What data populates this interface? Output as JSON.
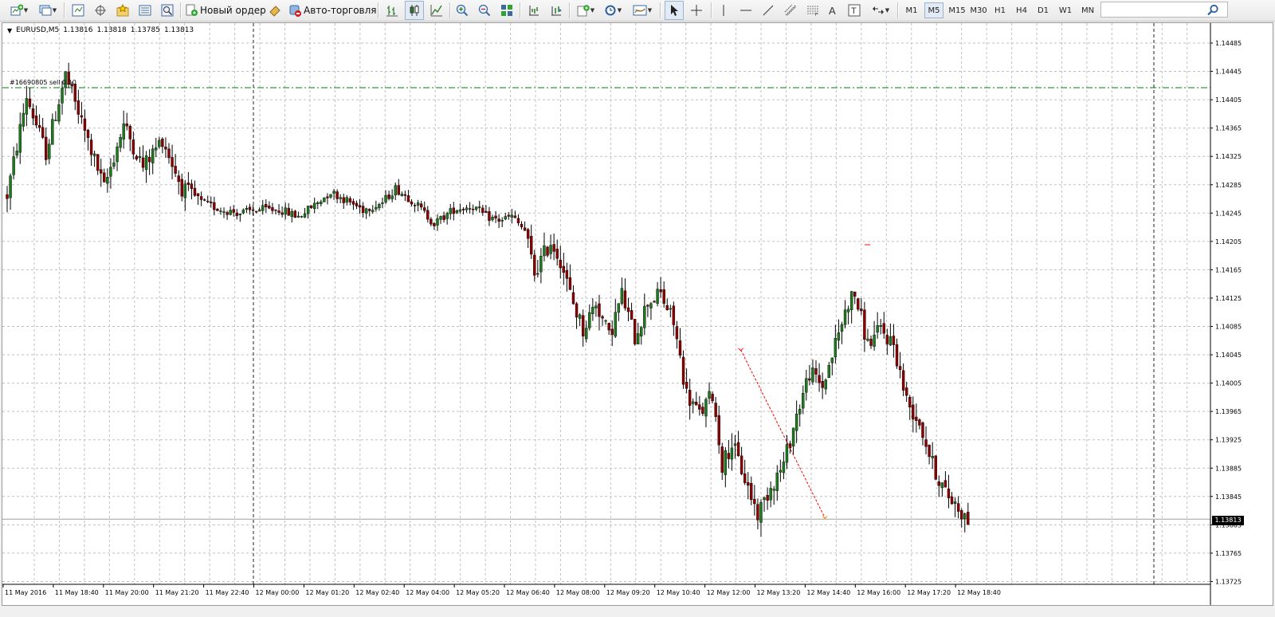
{
  "toolbar": {
    "new_order_label": "Новый ордер",
    "auto_trading_label": "Авто-торговля",
    "timeframes": [
      "M1",
      "M5",
      "M15",
      "M30",
      "H1",
      "H4",
      "D1",
      "W1",
      "MN"
    ],
    "active_timeframe": "M5",
    "icons": [
      "new-chart-icon",
      "profiles-icon",
      "market-watch-icon",
      "navigator-icon",
      "favorites-icon",
      "terminal-icon",
      "strategy-tester-icon",
      "new-order-icon",
      "meta-editor-icon",
      "auto-trading-icon",
      "bar-chart-icon",
      "candlesticks-icon",
      "line-chart-icon",
      "zoom-in-icon",
      "zoom-out-icon",
      "tile-windows-icon",
      "chart-shift-icon",
      "autoscroll-icon",
      "indicators-icon",
      "periods-icon",
      "templates-icon",
      "cursor-icon",
      "crosshair-icon",
      "vertical-line-icon",
      "horizontal-line-icon",
      "trendline-icon",
      "equidistant-channel-icon",
      "fibonacci-icon",
      "text-icon",
      "text-label-icon",
      "arrows-icon",
      "search-icon"
    ]
  },
  "chart": {
    "symbol": "EURUSD,M5",
    "ohlc": [
      "1.13816",
      "1.13818",
      "1.13785",
      "1.13813"
    ],
    "order_label": "#16690805 sell 0.10",
    "current_price": "1.13813",
    "colors": {
      "background": "#ffffff",
      "grid": "#c0c0c0",
      "bull": "#1f7a1f",
      "bear": "#8b0000",
      "order_line": "#008000",
      "trade_line": "#ff0000",
      "bid_line": "#a0a0a0"
    }
  },
  "chart_data": {
    "type": "candlestick",
    "symbol": "EURUSD",
    "timeframe": "M5",
    "y_ticks": [
      "1.14485",
      "1.14445",
      "1.14405",
      "1.14365",
      "1.14325",
      "1.14285",
      "1.14245",
      "1.14205",
      "1.14165",
      "1.14125",
      "1.14085",
      "1.14045",
      "1.14005",
      "1.13965",
      "1.13925",
      "1.13885",
      "1.13845",
      "1.13805",
      "1.13765",
      "1.13725"
    ],
    "x_ticks": [
      "11 May 2016",
      "11 May 18:40",
      "11 May 20:00",
      "11 May 21:20",
      "11 May 22:40",
      "12 May 00:00",
      "12 May 01:20",
      "12 May 02:40",
      "12 May 04:00",
      "12 May 05:20",
      "12 May 06:40",
      "12 May 08:00",
      "12 May 09:20",
      "12 May 10:40",
      "12 May 12:00",
      "12 May 13:20",
      "12 May 14:40",
      "12 May 16:00",
      "12 May 17:20",
      "12 May 18:40"
    ],
    "ylim": [
      1.137,
      1.145
    ],
    "order_price": 1.14422,
    "bid": 1.13813,
    "grid": true,
    "price_path": [
      [
        0,
        1.1427
      ],
      [
        6,
        1.1441
      ],
      [
        12,
        1.1433
      ],
      [
        18,
        1.1444
      ],
      [
        24,
        1.1436
      ],
      [
        30,
        1.1428
      ],
      [
        36,
        1.1437
      ],
      [
        42,
        1.1431
      ],
      [
        48,
        1.1435
      ],
      [
        54,
        1.1428
      ],
      [
        60,
        1.1426
      ],
      [
        66,
        1.1425
      ],
      [
        72,
        1.14245
      ],
      [
        78,
        1.1425
      ],
      [
        84,
        1.1425
      ],
      [
        90,
        1.1424
      ],
      [
        96,
        1.1426
      ],
      [
        100,
        1.14275
      ],
      [
        106,
        1.1426
      ],
      [
        110,
        1.1425
      ],
      [
        116,
        1.1426
      ],
      [
        120,
        1.1428
      ],
      [
        126,
        1.1426
      ],
      [
        132,
        1.1423
      ],
      [
        138,
        1.1425
      ],
      [
        144,
        1.14255
      ],
      [
        148,
        1.1424
      ],
      [
        152,
        1.14235
      ],
      [
        156,
        1.1424
      ],
      [
        160,
        1.1422
      ],
      [
        163,
        1.1416
      ],
      [
        168,
        1.14205
      ],
      [
        171,
        1.1418
      ],
      [
        174,
        1.1413
      ],
      [
        178,
        1.1408
      ],
      [
        182,
        1.1412
      ],
      [
        186,
        1.1407
      ],
      [
        190,
        1.1413
      ],
      [
        194,
        1.1407
      ],
      [
        198,
        1.1412
      ],
      [
        202,
        1.1413
      ],
      [
        206,
        1.1409
      ],
      [
        210,
        1.1399
      ],
      [
        214,
        1.1396
      ],
      [
        218,
        1.1399
      ],
      [
        221,
        1.1389
      ],
      [
        224,
        1.1392
      ],
      [
        228,
        1.1387
      ],
      [
        232,
        1.1382
      ],
      [
        236,
        1.1386
      ],
      [
        240,
        1.1389
      ],
      [
        244,
        1.1396
      ],
      [
        248,
        1.1402
      ],
      [
        252,
        1.14
      ],
      [
        256,
        1.1406
      ],
      [
        260,
        1.1412
      ],
      [
        262,
        1.1413
      ],
      [
        266,
        1.1406
      ],
      [
        270,
        1.1408
      ],
      [
        274,
        1.1406
      ],
      [
        278,
        1.1398
      ],
      [
        282,
        1.1395
      ],
      [
        286,
        1.1389
      ],
      [
        290,
        1.1385
      ],
      [
        294,
        1.1383
      ],
      [
        297,
        1.1381
      ]
    ],
    "trade_line": {
      "from": [
        226,
        1.14052
      ],
      "to": [
        252,
        1.13815
      ]
    }
  }
}
